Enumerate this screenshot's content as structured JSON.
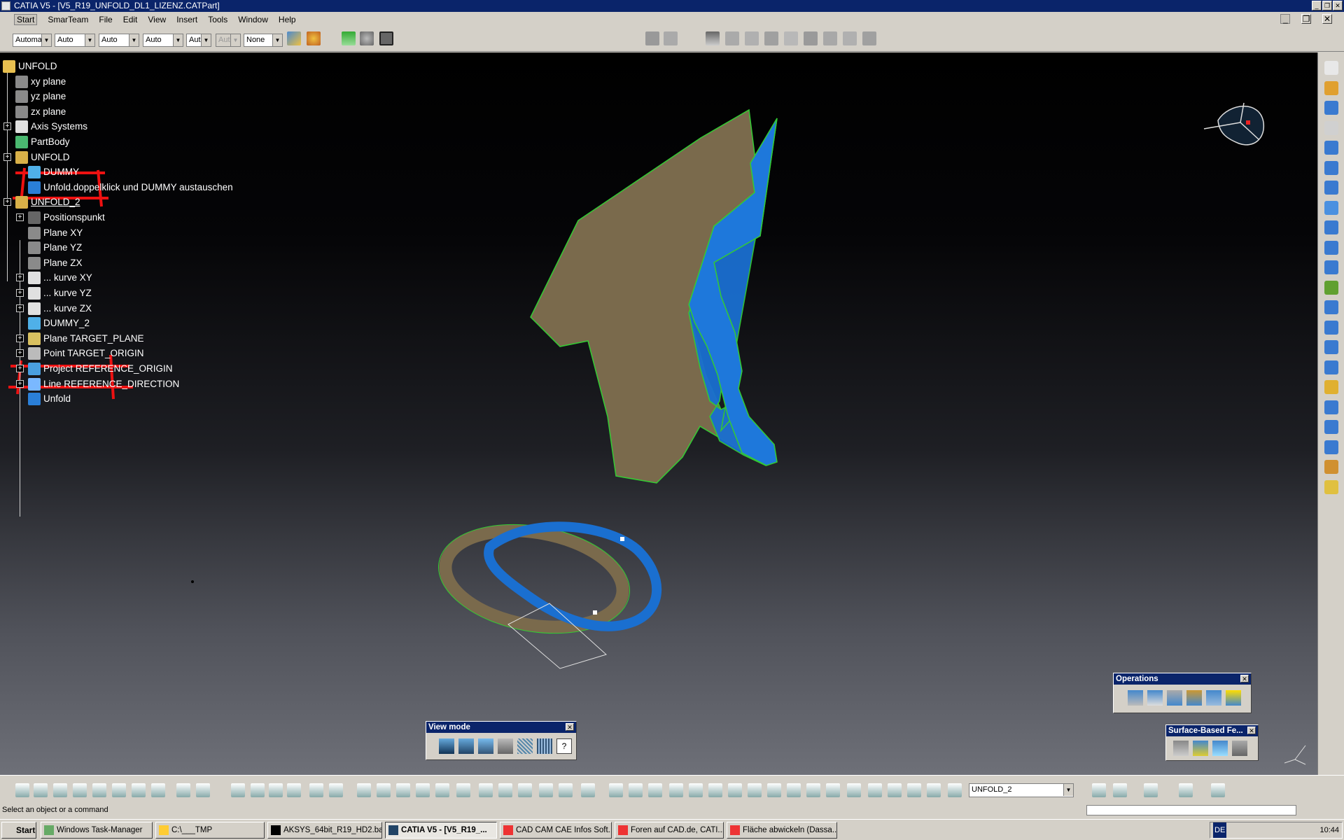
{
  "window": {
    "title": "CATIA V5 - [V5_R19_UNFOLD_DL1_LIZENZ.CATPart]"
  },
  "menu": [
    "Start",
    "SmarTeam",
    "File",
    "Edit",
    "View",
    "Insert",
    "Tools",
    "Window",
    "Help"
  ],
  "toolbar": {
    "combos": [
      "Automa",
      "Auto",
      "Auto",
      "Auto",
      "Aut",
      "Aut",
      "None"
    ],
    "current_body": "UNFOLD_2"
  },
  "tree": {
    "nodes": [
      {
        "label": "UNFOLD",
        "icon": "part-gear-icon"
      },
      {
        "label": "xy plane",
        "icon": "plane-icon"
      },
      {
        "label": "yz plane",
        "icon": "plane-icon"
      },
      {
        "label": "zx plane",
        "icon": "plane-icon"
      },
      {
        "label": "Axis Systems",
        "icon": "axis-system-icon"
      },
      {
        "label": "PartBody",
        "icon": "partbody-gear-icon"
      },
      {
        "label": "UNFOLD",
        "icon": "user-feature-icon"
      },
      {
        "label": "DUMMY",
        "icon": "surface-icon"
      },
      {
        "label": "Unfold.doppelklick und  DUMMY austauschen",
        "icon": "unfold-icon"
      },
      {
        "label": "UNFOLD_2",
        "icon": "user-feature-icon"
      },
      {
        "label": "Positionspunkt",
        "icon": "point-icon"
      },
      {
        "label": "Plane XY",
        "icon": "plane-icon"
      },
      {
        "label": "Plane YZ",
        "icon": "plane-icon"
      },
      {
        "label": "Plane ZX",
        "icon": "plane-icon"
      },
      {
        "label": "... kurve XY",
        "icon": "sketch-icon"
      },
      {
        "label": "... kurve YZ",
        "icon": "sketch-icon"
      },
      {
        "label": "... kurve ZX",
        "icon": "sketch-icon"
      },
      {
        "label": "DUMMY_2",
        "icon": "surface-icon"
      },
      {
        "label": "Plane   TARGET_PLANE",
        "icon": "plane-yellow-icon"
      },
      {
        "label": "Point   TARGET_ORIGIN",
        "icon": "point-small-icon"
      },
      {
        "label": "Project   REFERENCE_ORIGIN",
        "icon": "project-icon"
      },
      {
        "label": "Line   REFERENCE_DIRECTION",
        "icon": "line-icon"
      },
      {
        "label": "Unfold",
        "icon": "unfold-icon"
      }
    ]
  },
  "palettes": {
    "view_mode": {
      "title": "View mode"
    },
    "operations": {
      "title": "Operations"
    },
    "surface_based": {
      "title": "Surface-Based Fe..."
    }
  },
  "status": {
    "text": "Select an object or a command"
  },
  "taskbar": {
    "start": "Start",
    "tasks": [
      "Windows Task-Manager",
      "C:\\___TMP",
      "AKSYS_64bit_R19_HD2.bat",
      "CATIA V5 - [V5_R19_...",
      "CAD CAM CAE Infos Soft...",
      "Foren auf CAD.de, CATI...",
      "Fläche abwickeln (Dassa..."
    ],
    "lang": "DE",
    "time": "10:44"
  },
  "colors": {
    "title_bar": "#0a246a",
    "surface_tan": "#7a6a4c",
    "surface_blue": "#1a6fd0",
    "edge_green": "#33cc33",
    "markup_red": "#ee1111"
  }
}
